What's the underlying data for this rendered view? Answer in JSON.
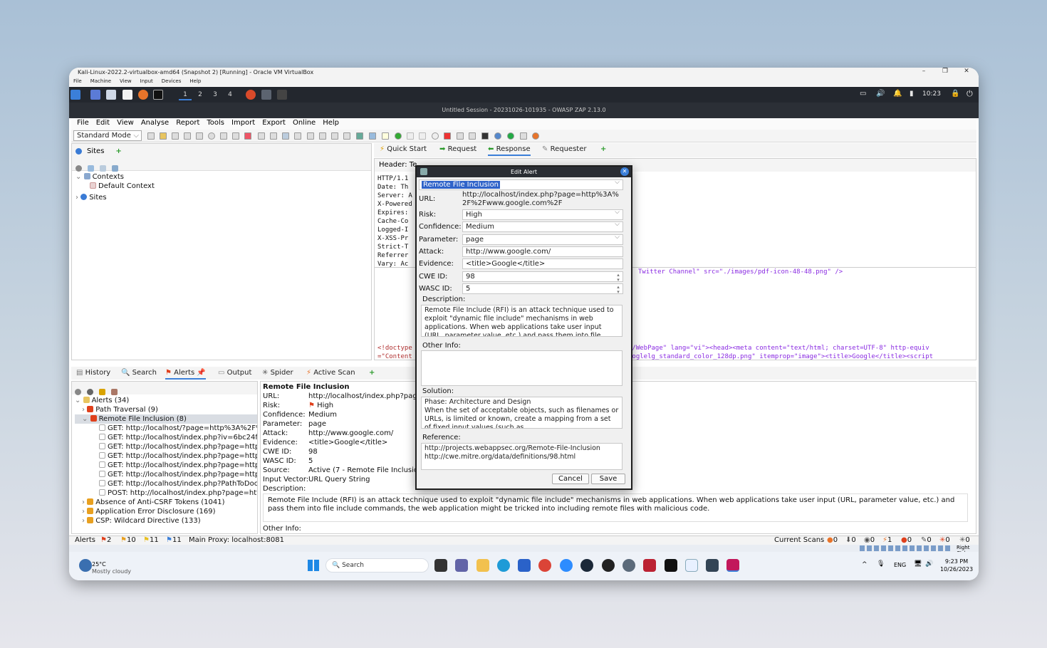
{
  "vbox": {
    "title": "Kali-Linux-2022.2-virtualbox-amd64 (Snapshot 2) [Running] - Oracle VM VirtualBox",
    "menu": [
      "File",
      "Machine",
      "View",
      "Input",
      "Devices",
      "Help"
    ],
    "min": "–",
    "max": "❐",
    "close": "✕"
  },
  "kali": {
    "workspaces": [
      "1",
      "2",
      "3",
      "4"
    ],
    "clock": "10:23"
  },
  "zap": {
    "title": "Untitled Session - 20231026-101935 - OWASP ZAP 2.13.0",
    "menu": [
      "File",
      "Edit",
      "View",
      "Analyse",
      "Report",
      "Tools",
      "Import",
      "Export",
      "Online",
      "Help"
    ],
    "mode": "Standard Mode"
  },
  "sites": {
    "tab": "Sites",
    "add": "+",
    "tree": [
      "Contexts",
      "Default Context",
      "Sites"
    ]
  },
  "work_tabs": {
    "quick_start": "Quick Start",
    "request": "Request",
    "response": "Response",
    "requester": "Requester",
    "add": "+"
  },
  "response": {
    "header_label": "Header: Te",
    "header_lines": [
      "HTTP/1.1",
      "Date: Th",
      "Server: A",
      "X-Powered",
      "Expires:",
      "Cache-Co",
      "Logged-I",
      "X-XSS-Pr",
      "Strict-T",
      "Referrer",
      "Vary: Ac"
    ],
    "body_line1": "g/WebPage\" lang=\"vi\"><head><meta content=\"text/html; charset=UTF-8\" http-equiv",
    "body_line2": "ooglelg_standard_color_128dp.png\" itemprop=\"image\"><title>Google</title><script",
    "body_doctype1": "<!doctype",
    "body_doctype2": "=\"Content",
    "body_twitter": "Twitter Channel\" src=\"./images/pdf-icon-48-48.png\" />"
  },
  "bottom_tabs": {
    "history": "History",
    "search": "Search",
    "alerts": "Alerts",
    "output": "Output",
    "spider": "Spider",
    "active_scan": "Active Scan",
    "add": "+"
  },
  "alerts_tree": {
    "root": "Alerts (34)",
    "items": [
      "Path Traversal (9)",
      "Remote File Inclusion (8)"
    ],
    "children": [
      "GET: http://localhost/?page=http%3A%2F%",
      "GET: http://localhost/index.php?iv=6bc24f",
      "GET: http://localhost/index.php?page=http",
      "GET: http://localhost/index.php?page=http",
      "GET: http://localhost/index.php?page=http",
      "GET: http://localhost/index.php?page=http",
      "GET: http://localhost/index.php?PathToDoc",
      "POST: http://localhost/index.php?page=htt"
    ],
    "more": [
      "Absence of Anti-CSRF Tokens (1041)",
      "Application Error Disclosure (169)",
      "CSP: Wildcard Directive (133)"
    ]
  },
  "alert_detail": {
    "title": "Remote File Inclusion",
    "rows": [
      [
        "URL:",
        "http://localhost/index.php?page"
      ],
      [
        "Risk:",
        "High"
      ],
      [
        "Confidence:",
        "Medium"
      ],
      [
        "Parameter:",
        "page"
      ],
      [
        "Attack:",
        "http://www.google.com/"
      ],
      [
        "Evidence:",
        "<title>Google</title>"
      ],
      [
        "CWE ID:",
        "98"
      ],
      [
        "WASC ID:",
        "5"
      ],
      [
        "Source:",
        "Active (7 - Remote File Inclusio"
      ],
      [
        "Input Vector:",
        "URL Query String"
      ]
    ],
    "desc_label": "Description:",
    "description": "Remote File Include (RFI) is an attack technique used to exploit \"dynamic file include\" mechanisms in web applications. When web applications take user input (URL, parameter value, etc.) and pass them into file include commands, the web application might be tricked into including remote files with malicious code.",
    "other_label": "Other Info:"
  },
  "dialog": {
    "title": "Edit Alert",
    "name": "Remote File Inclusion",
    "url_label": "URL:",
    "url": "http://localhost/index.php?page=http%3A%2F%2Fwww.google.com%2F",
    "risk_label": "Risk:",
    "risk": "High",
    "confidence_label": "Confidence:",
    "confidence": "Medium",
    "parameter_label": "Parameter:",
    "parameter": "page",
    "attack_label": "Attack:",
    "attack": "http://www.google.com/",
    "evidence_label": "Evidence:",
    "evidence": "<title>Google</title>",
    "cwe_label": "CWE ID:",
    "cwe": "98",
    "wasc_label": "WASC ID:",
    "wasc": "5",
    "desc_label": "Description:",
    "description": "Remote File Include (RFI) is an attack technique used to exploit \"dynamic file include\" mechanisms in web applications. When web applications take user input (URL, parameter value, etc.) and pass them into file",
    "other_label": "Other Info:",
    "solution_label": "Solution:",
    "solution": "Phase: Architecture and Design\nWhen the set of acceptable objects, such as filenames or URLs, is limited or known, create a mapping from a set of fixed input values (such as",
    "reference_label": "Reference:",
    "reference": "http://projects.webappsec.org/Remote-File-Inclusion\nhttp://cwe.mitre.org/data/definitions/98.html",
    "cancel": "Cancel",
    "save": "Save"
  },
  "statusbar": {
    "alerts": "Alerts",
    "high": "2",
    "medium": "10",
    "low": "11",
    "info": "11",
    "proxy": "Main Proxy: localhost:8081",
    "current_scans": "Current Scans",
    "counts": [
      "0",
      "0",
      "0",
      "1",
      "0",
      "0",
      "0",
      "0"
    ]
  },
  "host": {
    "right_ctrl": "Right Ctrl",
    "weather_temp": "25°C",
    "weather_desc": "Mostly cloudy",
    "search": "Search",
    "lang": "ENG",
    "time": "9:23 PM",
    "date": "10/26/2023"
  },
  "colors": {
    "risk_high": "#e0401c",
    "dialog_title": "#2a2d33",
    "selection": "#2f63c9"
  }
}
